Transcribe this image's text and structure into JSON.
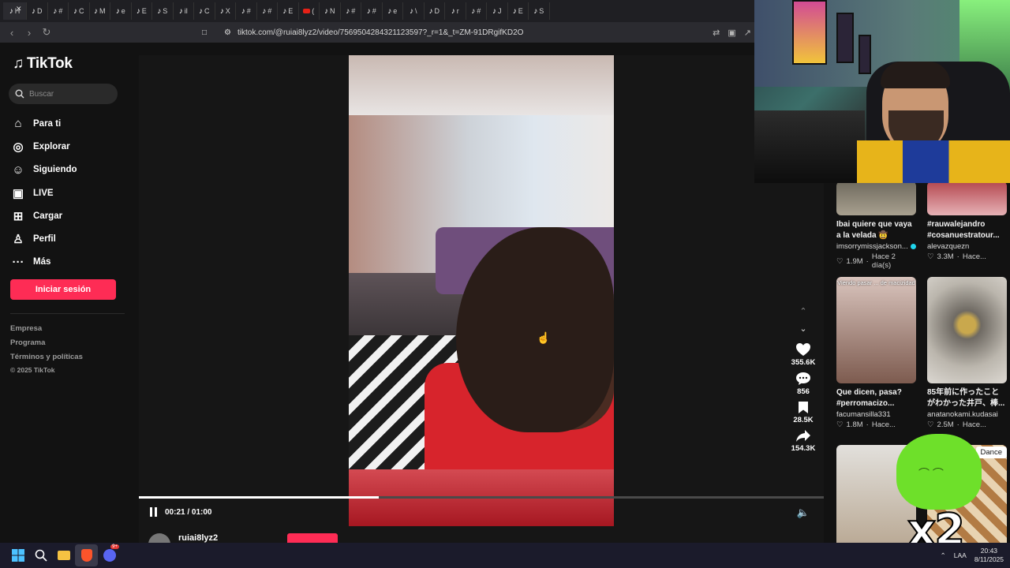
{
  "browser": {
    "tabs": [
      "H",
      "D",
      "#",
      "C",
      "M",
      "e",
      "E",
      "S",
      "il",
      "C",
      "X",
      "#",
      "#",
      "E",
      "(",
      "N",
      "#",
      "#",
      "e",
      "\\",
      "D",
      "r",
      "#",
      "J",
      "E",
      "S"
    ],
    "url": "tiktok.com/@ruiai8lyz2/video/7569504284321123597?_r=1&_t=ZM-91DRgifKD2O"
  },
  "sidebar": {
    "logo": "TikTok",
    "search_placeholder": "Buscar",
    "nav": [
      {
        "label": "Para ti",
        "icon": "home-icon"
      },
      {
        "label": "Explorar",
        "icon": "compass-icon"
      },
      {
        "label": "Siguiendo",
        "icon": "following-icon"
      },
      {
        "label": "LIVE",
        "icon": "live-icon"
      },
      {
        "label": "Cargar",
        "icon": "upload-icon"
      },
      {
        "label": "Perfil",
        "icon": "profile-icon"
      },
      {
        "label": "Más",
        "icon": "more-icon"
      }
    ],
    "login_label": "Iniciar sesión",
    "footer": [
      "Empresa",
      "Programa",
      "Términos y políticas"
    ],
    "copyright": "© 2025 TikTok"
  },
  "player": {
    "time": "00:21 / 01:00",
    "progress": 0.35,
    "author": "ruiai8lyz2"
  },
  "actions": {
    "likes": "355.6K",
    "comments": "856",
    "saves": "28.5K",
    "shares": "154.3K"
  },
  "recommended": [
    {
      "caption": "Ibai quiere que vaya a la velada 🤠",
      "user": "imsorrymissjackson...",
      "verified": true,
      "likes": "1.9M",
      "age": "Hace 2 día(s)"
    },
    {
      "caption": "#rauwalejandro #cosanuestratour...",
      "user": "alevazquezn",
      "verified": false,
      "likes": "3.3M",
      "age": "Hace..."
    },
    {
      "caption": "Que dicen, pasa? #perromacizo...",
      "user": "facumansilla331",
      "verified": false,
      "likes": "1.8M",
      "age": "Hace..."
    },
    {
      "caption": "85年前に作ったことがわかった井戸、棒...",
      "user": "anatanokami.kudasai",
      "verified": false,
      "likes": "2.5M",
      "age": "Hace..."
    },
    {
      "caption": "",
      "user": "",
      "verified": false,
      "likes": "",
      "age": "",
      "badge": "Dance"
    }
  ],
  "thumb_text": {
    "overlay_1": "Viendo pasar ... de macizidad"
  },
  "overlay": {
    "multiplier": "x2"
  },
  "taskbar": {
    "lang": "LAA",
    "time": "20:43",
    "date": "8/11/2025",
    "discord_badge": "9+"
  },
  "colors": {
    "accent": "#fe2c55",
    "verified": "#20d5ec",
    "blob": "#6ee02a"
  }
}
